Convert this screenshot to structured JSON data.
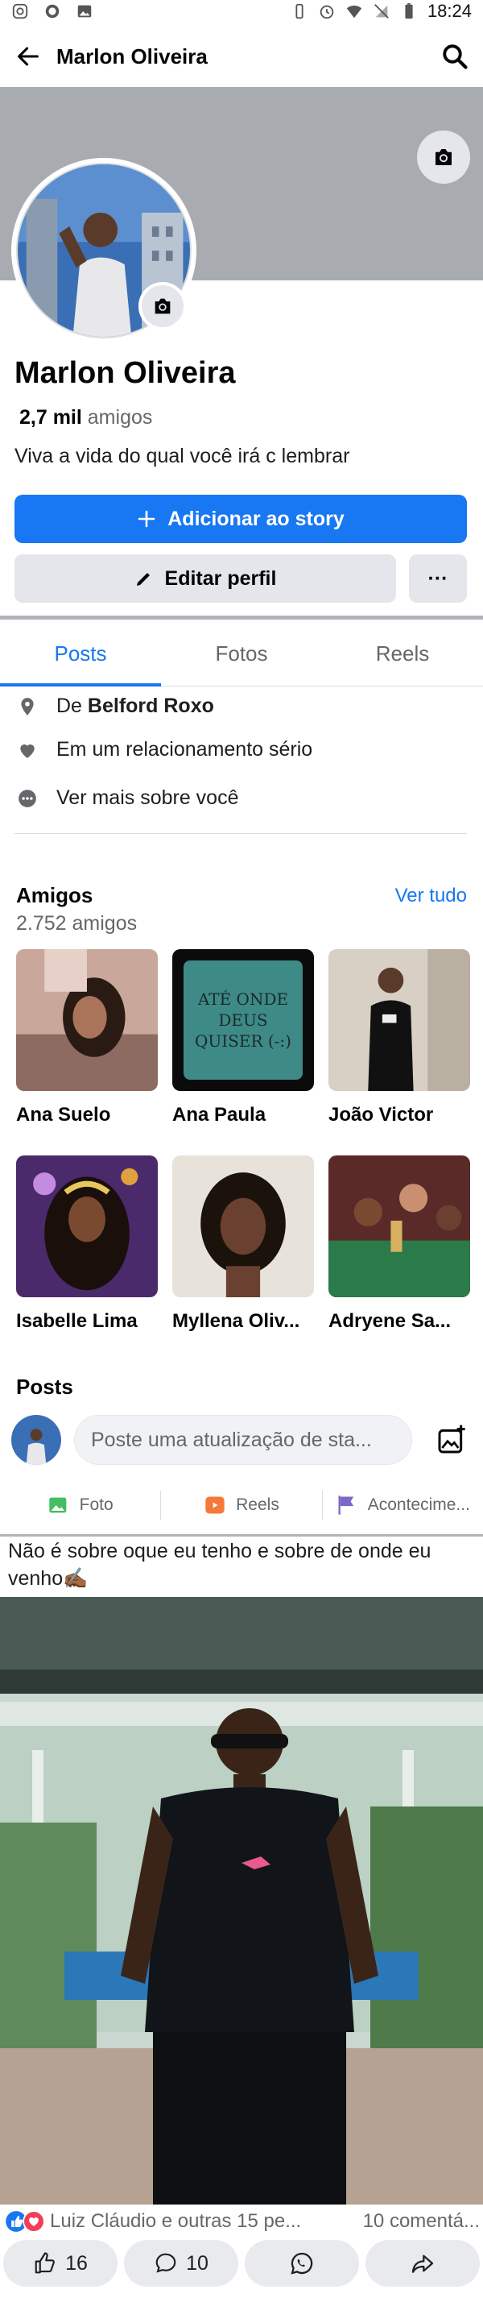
{
  "status_bar": {
    "time": "18:24",
    "left_icons": [
      "instagram-icon",
      "whatsapp-icon",
      "gallery-icon"
    ],
    "right_icons": [
      "vibrate-icon",
      "alarm-icon",
      "wifi-icon",
      "no-sim-icon",
      "battery-icon"
    ]
  },
  "header": {
    "title": "Marlon Oliveira"
  },
  "profile": {
    "name": "Marlon Oliveira",
    "friends_count": "2,7 mil",
    "friends_label": "amigos",
    "bio": "Viva a vida do qual você irá c lembrar",
    "add_story_label": "Adicionar ao story",
    "edit_profile_label": "Editar perfil",
    "more_label": "···"
  },
  "tabs": [
    "Posts",
    "Fotos",
    "Reels"
  ],
  "details": {
    "from_prefix": "De",
    "from_city": "Belford Roxo",
    "relationship": "Em um relacionamento sério",
    "see_more": "Ver mais sobre você"
  },
  "friends": {
    "title": "Amigos",
    "count_text": "2.752 amigos",
    "see_all": "Ver tudo",
    "list": [
      {
        "name": "Ana Suelo"
      },
      {
        "name": "Ana Paula",
        "photo_text": "ATÉ ONDE DEUS QUISER (-:)"
      },
      {
        "name": "João Victor"
      },
      {
        "name": "Isabelle Lima"
      },
      {
        "name": "Myllena Oliv..."
      },
      {
        "name": "Adryene Sa..."
      }
    ]
  },
  "posts_section": {
    "title": "Posts",
    "composer_placeholder": "Poste uma atualização de sta...",
    "actions": [
      "Foto",
      "Reels",
      "Acontecime..."
    ]
  },
  "post": {
    "text": "Não é sobre oque eu tenho e sobre de onde eu venho✍🏾",
    "reactions_text": "Luiz Cláudio e outras 15 pe...",
    "comments_text": "10 comentá...",
    "like_count": "16",
    "comment_count": "10"
  },
  "colors": {
    "accent": "#1877f2",
    "cover": "#a8abb0",
    "button_gray": "#e4e6eb"
  }
}
